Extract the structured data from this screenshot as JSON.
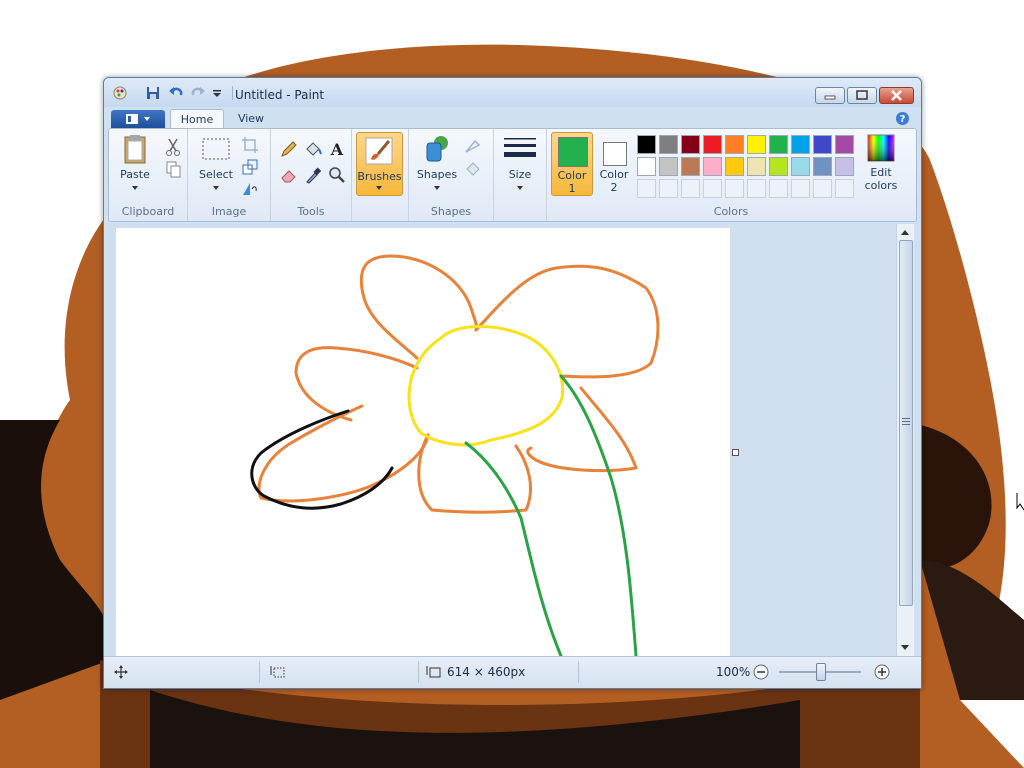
{
  "window": {
    "title": "Untitled - Paint",
    "tabs": [
      "Home",
      "View"
    ]
  },
  "ribbon": {
    "clipboard": {
      "label": "Clipboard",
      "paste": "Paste"
    },
    "image": {
      "label": "Image",
      "select": "Select"
    },
    "tools": {
      "label": "Tools",
      "text_tool": "A"
    },
    "brushes": {
      "label": "Brushes"
    },
    "shapes": {
      "label": "Shapes",
      "button": "Shapes"
    },
    "size": {
      "label": "Size"
    },
    "colors": {
      "label": "Colors",
      "color1": {
        "line1": "Color",
        "line2": "1",
        "value": "#22b14c"
      },
      "color2": {
        "line1": "Color",
        "line2": "2",
        "value": "#ffffff"
      },
      "edit_line1": "Edit",
      "edit_line2": "colors",
      "palette_row1": [
        "#000000",
        "#7f7f7f",
        "#880015",
        "#ed1c24",
        "#ff7f27",
        "#fff200",
        "#22b14c",
        "#00a2e8",
        "#3f48cc",
        "#a349a4"
      ],
      "palette_row2": [
        "#ffffff",
        "#c3c3c3",
        "#b97a57",
        "#ffaec9",
        "#ffc90e",
        "#efe4b0",
        "#b5e61d",
        "#99d9ea",
        "#7092be",
        "#c8bfe7"
      ]
    }
  },
  "status": {
    "canvas_size": "614 × 460px",
    "zoom": "100%"
  },
  "drawing": {
    "colors": {
      "petals": "#e8823a",
      "center": "#f7e21b",
      "stem": "#2aa347",
      "outline": "#111111"
    }
  }
}
